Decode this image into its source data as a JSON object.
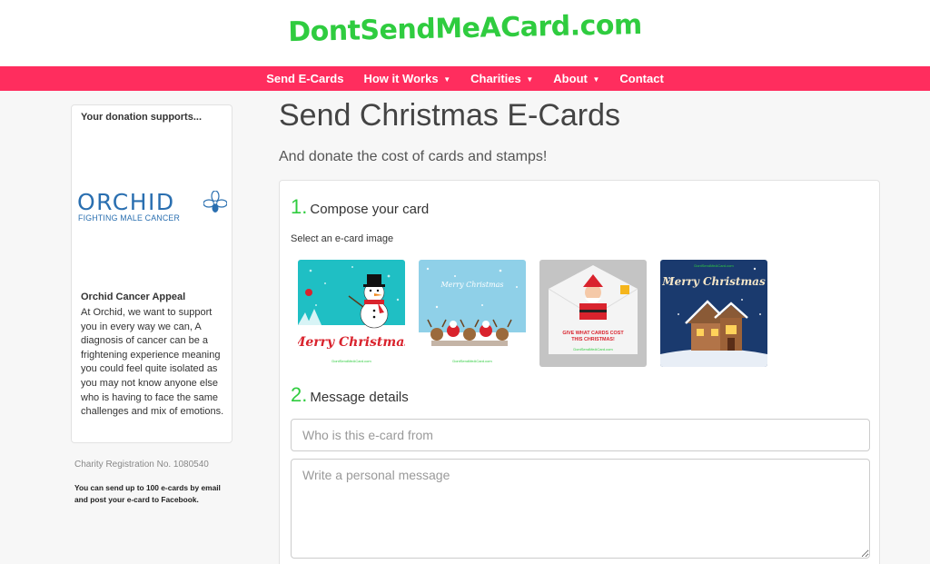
{
  "site": {
    "logo_text": "DontSendMeACard.com"
  },
  "nav": {
    "items": [
      {
        "label": "Send E-Cards",
        "dropdown": false
      },
      {
        "label": "How it Works",
        "dropdown": true
      },
      {
        "label": "Charities",
        "dropdown": true
      },
      {
        "label": "About",
        "dropdown": true
      },
      {
        "label": "Contact",
        "dropdown": false
      }
    ],
    "caret": "▼"
  },
  "sidebar": {
    "heading": "Your donation supports...",
    "charity_logo": {
      "word": "ORCHID",
      "tagline": "FIGHTING MALE CANCER",
      "icon": "orchid-flower-icon"
    },
    "appeal_title": "Orchid Cancer Appeal",
    "appeal_text": "At Orchid, we want to support you in every way we can, A diagnosis of cancer can be a frightening experience meaning you could feel quite isolated as you may not know anyone else who is having to face the same challenges and mix of emotions.",
    "registration": "Charity Registration No. 1080540",
    "limit_note": "You can send up to 100 e-cards by email and post your e-card to Facebook."
  },
  "main": {
    "title": "Send Christmas E-Cards",
    "subtitle": "And donate the cost of cards and stamps!",
    "step1": {
      "number": "1.",
      "label": "Compose your card"
    },
    "select_label": "Select an e-card image",
    "cards": [
      {
        "name": "snowman-card",
        "text": "Merry Christmas",
        "footer": "DontSendMeACard.com",
        "bg": "#1fbfc4"
      },
      {
        "name": "reindeer-card",
        "text": "Merry Christmas",
        "footer": "DontSendMeACard.com",
        "bg": "#8fd0e8"
      },
      {
        "name": "santa-envelope-card",
        "text": "GIVE WHAT CARDS COST THIS CHRISTMAS!",
        "footer": "DontSendMeACard.com",
        "bg": "#c4c4c4"
      },
      {
        "name": "house-card",
        "text": "Merry Christmas",
        "footer": "DontSendMeACard.com",
        "bg": "#1a3a6e"
      }
    ],
    "step2": {
      "number": "2.",
      "label": "Message details"
    },
    "from_placeholder": "Who is this e-card from",
    "message_placeholder": "Write a personal message"
  },
  "colors": {
    "brand_green": "#2fcc3f",
    "nav_pink": "#ff2d5e",
    "orchid_blue": "#2a6fb0"
  }
}
